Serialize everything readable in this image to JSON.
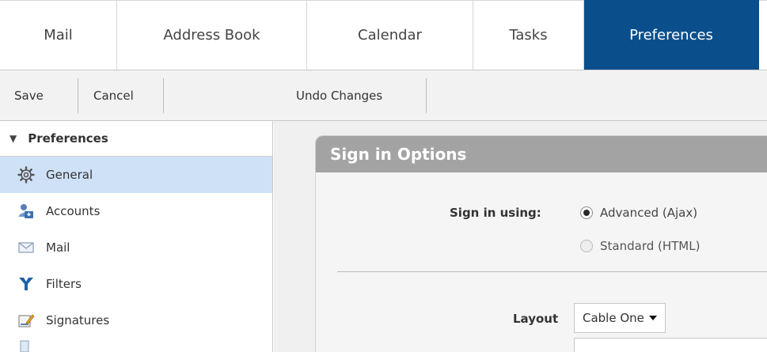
{
  "tabs": [
    {
      "label": "Mail",
      "active": false
    },
    {
      "label": "Address Book",
      "active": false
    },
    {
      "label": "Calendar",
      "active": false
    },
    {
      "label": "Tasks",
      "active": false
    },
    {
      "label": "Preferences",
      "active": true
    }
  ],
  "toolbar": {
    "save_label": "Save",
    "cancel_label": "Cancel",
    "undo_label": "Undo Changes"
  },
  "sidebar": {
    "header": "Preferences",
    "items": [
      {
        "label": "General",
        "icon": "gear-icon",
        "selected": true
      },
      {
        "label": "Accounts",
        "icon": "accounts-icon",
        "selected": false
      },
      {
        "label": "Mail",
        "icon": "mail-icon",
        "selected": false
      },
      {
        "label": "Filters",
        "icon": "filters-icon",
        "selected": false
      },
      {
        "label": "Signatures",
        "icon": "signature-icon",
        "selected": false
      }
    ]
  },
  "main": {
    "panel_title": "Sign in Options",
    "sign_in_label": "Sign in using:",
    "options": [
      {
        "label": "Advanced (Ajax)",
        "checked": true
      },
      {
        "label": "Standard (HTML)",
        "checked": false
      }
    ],
    "layout_label": "Layout",
    "layout_value": "Cable One"
  },
  "colors": {
    "active_tab": "#0a4f8c",
    "selected_item": "#cfe1f7",
    "panel_header": "#a3a3a3"
  }
}
